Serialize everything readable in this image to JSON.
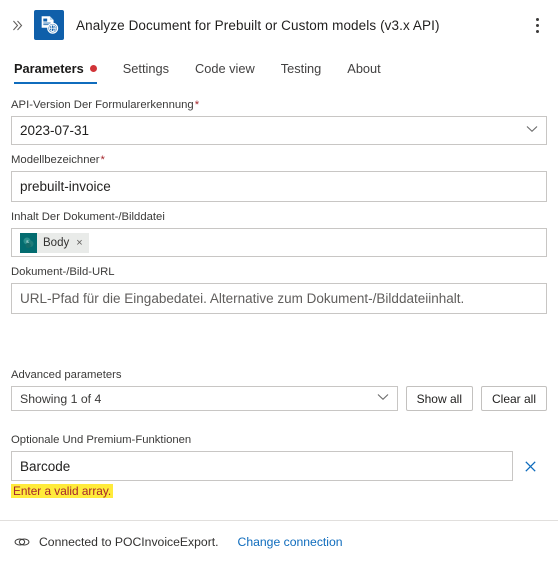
{
  "header": {
    "collapse_icon": "chevron-double-right-icon",
    "app_icon": "analyze-document-icon",
    "title": "Analyze Document for Prebuilt or Custom models (v3.x API)",
    "menu_icon": "more-vertical-icon"
  },
  "tabs": [
    {
      "label": "Parameters",
      "active": true,
      "has_dot": true
    },
    {
      "label": "Settings",
      "active": false,
      "has_dot": false
    },
    {
      "label": "Code view",
      "active": false,
      "has_dot": false
    },
    {
      "label": "Testing",
      "active": false,
      "has_dot": false
    },
    {
      "label": "About",
      "active": false,
      "has_dot": false
    }
  ],
  "fields": {
    "api_version": {
      "label": "API-Version Der Formularerkennung",
      "required": "*",
      "value": "2023-07-31",
      "chevron_icon": "chevron-down-icon"
    },
    "model_id": {
      "label": "Modellbezeichner",
      "required": "*",
      "value": "prebuilt-invoice"
    },
    "file_content": {
      "label": "Inhalt Der Dokument-/Bilddatei",
      "token_label": "Body",
      "token_icon": "sharepoint-icon",
      "token_remove_icon": "close-icon"
    },
    "file_url": {
      "label": "Dokument-/Bild-URL",
      "placeholder": "URL-Pfad für die Eingabedatei. Alternative zum Dokument-/Bilddateiinhalt.",
      "value": ""
    }
  },
  "advanced": {
    "label": "Advanced parameters",
    "select_value": "Showing 1 of 4",
    "chevron_icon": "chevron-down-icon",
    "show_all_label": "Show all",
    "clear_all_label": "Clear all"
  },
  "optional_features": {
    "label": "Optionale Und Premium-Funktionen",
    "value": "Barcode",
    "clear_icon": "close-icon",
    "error": "Enter a valid array."
  },
  "footer": {
    "link_icon": "connection-link-icon",
    "status": "Connected to POCInvoiceExport.",
    "change_link": "Change connection"
  },
  "colors": {
    "accent": "#0f6cbd",
    "app_icon_bg": "#0f5faa",
    "required_red": "#a4262c",
    "tab_dot_red": "#d13438",
    "error_highlight": "#ffeb3b",
    "token_icon_teal": "#036c70",
    "border": "#c8c6c4"
  }
}
